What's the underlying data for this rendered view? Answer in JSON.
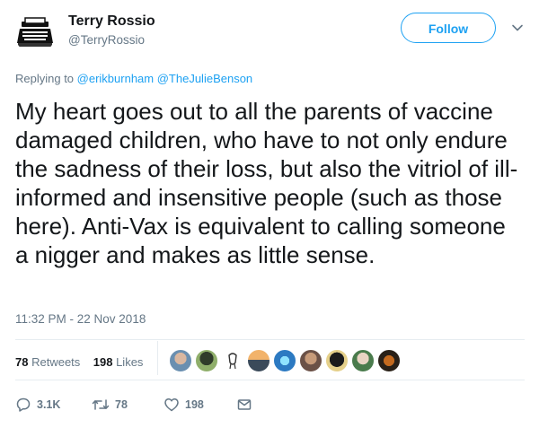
{
  "author": {
    "name": "Terry Rossio",
    "handle": "@TerryRossio",
    "avatar_icon": "typewriter-icon"
  },
  "follow_label": "Follow",
  "reply": {
    "prefix": "Replying to ",
    "mentions": [
      "@erikburnham",
      "@TheJulieBenson"
    ]
  },
  "tweet_text": "My heart goes out to all the parents of vaccine damaged children, who have to not only endure the sadness of their loss, but also the vitriol of ill-informed and insensitive people (such as those here). Anti-Vax is equivalent to calling someone a nigger and makes as little sense.",
  "timestamp": "11:32 PM - 22 Nov 2018",
  "stats": {
    "retweets_count": "78",
    "retweets_label": "Retweets",
    "likes_count": "198",
    "likes_label": "Likes"
  },
  "actions": {
    "replies": "3.1K",
    "retweets": "78",
    "likes": "198"
  },
  "colors": {
    "accent": "#1da1f2",
    "muted": "#657786",
    "text": "#14171a"
  }
}
